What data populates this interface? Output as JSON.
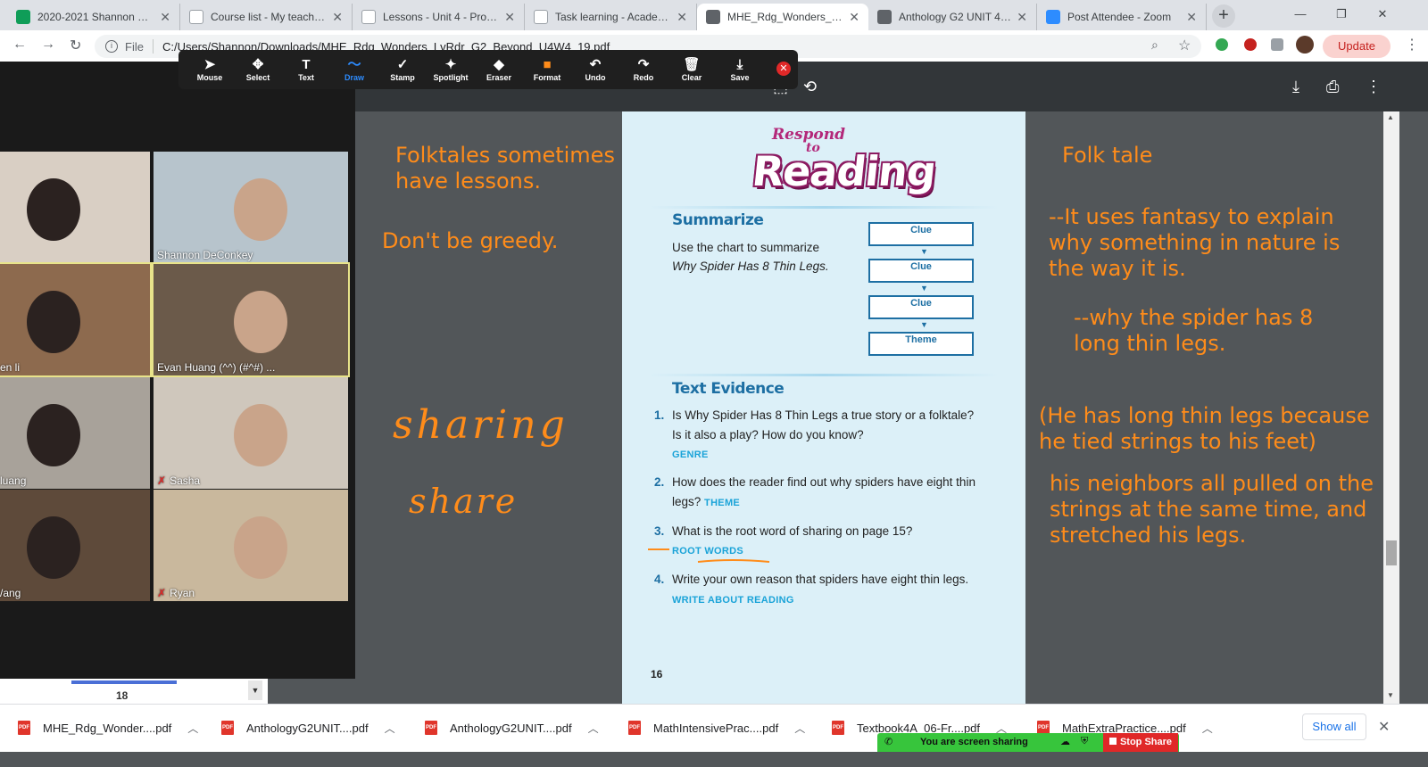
{
  "browser": {
    "tabs": [
      {
        "label": "2020-2021 Shannon DeC",
        "icon": "sheets-icon",
        "color": "#0f9d58"
      },
      {
        "label": "Course list - My teaching",
        "icon": "doc-icon",
        "color": "#ffffff"
      },
      {
        "label": "Lessons - Unit 4 - Progra",
        "icon": "doc-icon",
        "color": "#ffffff"
      },
      {
        "label": "Task learning - Academy",
        "icon": "doc-icon",
        "color": "#ffffff"
      },
      {
        "label": "MHE_Rdg_Wonders_LvR",
        "icon": "globe-icon",
        "color": "#5f6368"
      },
      {
        "label": "Anthology G2 UNIT 4.pd",
        "icon": "globe-icon",
        "color": "#5f6368"
      },
      {
        "label": "Post Attendee - Zoom",
        "icon": "zoom-icon",
        "color": "#2d8cff"
      }
    ],
    "active_tab": 4,
    "address": {
      "scheme_label": "File",
      "url": "C:/Users/Shannon/Downloads/MHE_Rdg_Wonders_LvRdr_G2_Beyond_U4W4_19.pdf"
    },
    "update_label": "Update"
  },
  "annotation_toolbar": {
    "tools": [
      {
        "label": "Mouse",
        "icon": "cursor-icon",
        "glyph": "➤"
      },
      {
        "label": "Select",
        "icon": "move-icon",
        "glyph": "✥"
      },
      {
        "label": "Text",
        "icon": "text-icon",
        "glyph": "T"
      },
      {
        "label": "Draw",
        "icon": "draw-icon",
        "glyph": "〜"
      },
      {
        "label": "Stamp",
        "icon": "check-icon",
        "glyph": "✓"
      },
      {
        "label": "Spotlight",
        "icon": "spotlight-icon",
        "glyph": "✦"
      },
      {
        "label": "Eraser",
        "icon": "eraser-icon",
        "glyph": "◆"
      },
      {
        "label": "Format",
        "icon": "format-icon",
        "glyph": "■"
      },
      {
        "label": "Undo",
        "icon": "undo-icon",
        "glyph": "↶"
      },
      {
        "label": "Redo",
        "icon": "redo-icon",
        "glyph": "↷"
      },
      {
        "label": "Clear",
        "icon": "trash-icon",
        "glyph": "🗑"
      },
      {
        "label": "Save",
        "icon": "save-icon",
        "glyph": "⤓"
      }
    ],
    "active_tool": "Draw",
    "format_color": "#ff8c1a"
  },
  "gallery": {
    "participants": [
      {
        "name": "",
        "bg": "#d9cfc4"
      },
      {
        "name": "Shannon DeConkey",
        "bg": "#b7c4cc"
      },
      {
        "name": "en li",
        "bg": "#8d6a4e"
      },
      {
        "name": "Evan Huang (^^) (#^#) ...",
        "bg": "#6b5a4a"
      },
      {
        "name": "luang",
        "bg": "#a8a29a"
      },
      {
        "name": "Sasha",
        "bg": "#cfc7bc",
        "muted": true
      },
      {
        "name": "/ang",
        "bg": "#5e4a3a"
      },
      {
        "name": "Ryan",
        "bg": "#c9b89d",
        "muted": true
      }
    ],
    "page": "18"
  },
  "pdf_page": {
    "header_small": "Respond",
    "header_to": "to",
    "header_big": "Reading",
    "summarize": {
      "title": "Summarize",
      "line1": "Use the chart to summarize",
      "line2": "Why Spider Has 8 Thin Legs.",
      "boxes": [
        "Clue",
        "Clue",
        "Clue",
        "Theme"
      ]
    },
    "evidence": {
      "title": "Text Evidence",
      "questions": [
        {
          "num": "1.",
          "text": "Is Why Spider Has 8 Thin Legs a true story or a folktale? Is it also a play? How do you know?",
          "tag": "GENRE"
        },
        {
          "num": "2.",
          "text": "How does the reader find out why spiders have eight thin legs?",
          "tag": "THEME"
        },
        {
          "num": "3.",
          "text": "What is the root word of sharing on page 15?",
          "tag": "ROOT WORDS"
        },
        {
          "num": "4.",
          "text": "Write your own reason that spiders have eight thin legs.",
          "tag": "WRITE ABOUT READING"
        }
      ]
    },
    "page_number": "16"
  },
  "annotations": {
    "left_1": "Folktales sometimes have lessons.",
    "left_2": "Don't be greedy.",
    "hand_1": "sharing",
    "hand_2": "share",
    "right_1": "Folk tale",
    "right_2": "--It uses fantasy to explain why something in nature is the way it is.",
    "right_3": "--why the spider has 8 long thin legs.",
    "right_4": "(He has long thin legs because he tied strings to his feet)",
    "right_5": "his neighbors all pulled on the strings at the same time, and stretched his legs.",
    "color": "#ff8c1a"
  },
  "downloads": {
    "items": [
      "MHE_Rdg_Wonder....pdf",
      "AnthologyG2UNIT....pdf",
      "AnthologyG2UNIT....pdf",
      "MathIntensivePrac....pdf",
      "Textbook4A_06-Fr....pdf",
      "MathExtraPractice....pdf"
    ],
    "show_all": "Show all"
  },
  "zoom_share": {
    "status": "You are screen sharing",
    "stop": "Stop Share"
  }
}
